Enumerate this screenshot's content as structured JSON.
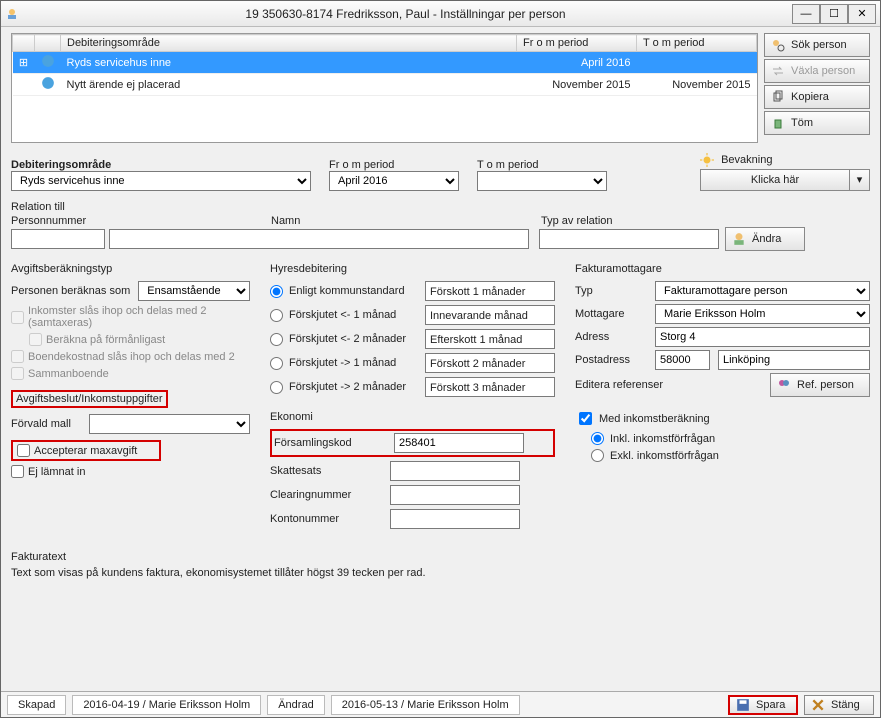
{
  "window": {
    "title": "19 350630-8174 Fredriksson, Paul - Inställningar per person"
  },
  "grid": {
    "headers": {
      "area": "Debiteringsområde",
      "from": "Fr o m period",
      "to": "T o m period"
    },
    "rows": [
      {
        "area": "Ryds servicehus inne",
        "from": "April 2016",
        "to": "",
        "selected": true,
        "expand": true
      },
      {
        "area": "Nytt ärende ej placerad",
        "from": "November 2015",
        "to": "November 2015",
        "selected": false,
        "expand": false
      }
    ]
  },
  "buttons": {
    "sok": "Sök person",
    "vaxla": "Växla person",
    "kopiera": "Kopiera",
    "tom": "Töm"
  },
  "filters": {
    "area_label": "Debiteringsområde",
    "area_value": "Ryds servicehus inne",
    "from_label": "Fr o m period",
    "from_value": "April 2016",
    "to_label": "T o m period",
    "to_value": ""
  },
  "bevak": {
    "label": "Bevakning",
    "button": "Klicka här"
  },
  "relation": {
    "header": "Relation till",
    "pnr": "Personnummer",
    "namn": "Namn",
    "typ": "Typ av relation",
    "andra": "Ändra"
  },
  "avgift": {
    "header": "Avgiftsberäkningstyp",
    "beraknas_label": "Personen beräknas som",
    "beraknas_value": "Ensamstående",
    "cb_inkomster": "Inkomster slås ihop och delas med 2 (samtaxeras)",
    "cb_forman": "Beräkna på förmånligast",
    "cb_boende": "Boendekostnad slås ihop och delas med 2",
    "cb_sambo": "Sammanboende",
    "beslut_header": "Avgiftsbeslut/Inkomstuppgifter",
    "mall_label": "Förvald mall",
    "cb_max": "Accepterar maxavgift",
    "cb_ej": "Ej lämnat in"
  },
  "hyra": {
    "header": "Hyresdebitering",
    "opt_std": "Enligt kommunstandard",
    "opt_b1": "Förskjutet <- 1 månad",
    "opt_b2": "Förskjutet <- 2 månader",
    "opt_f1": "Förskjutet -> 1 månad",
    "opt_f2": "Förskjutet -> 2 månader",
    "val_std": "Förskott 1 månader",
    "val_b1": "Innevarande månad",
    "val_b2": "Efterskott 1 månad",
    "val_f1": "Förskott 2 månader",
    "val_f2": "Förskott 3 månader",
    "ekonomi": "Ekonomi",
    "forsamling_label": "Församlingskod",
    "forsamling_value": "258401",
    "skatt": "Skattesats",
    "clearing": "Clearingnummer",
    "konto": "Kontonummer"
  },
  "faktmott": {
    "header": "Fakturamottagare",
    "typ_label": "Typ",
    "typ_value": "Fakturamottagare person",
    "mott_label": "Mottagare",
    "mott_value": "Marie Eriksson Holm",
    "adr_label": "Adress",
    "adr_value": "Storg 4",
    "post_label": "Postadress",
    "post_zip": "58000",
    "post_city": "Linköping",
    "editref": "Editera referenser",
    "refperson": "Ref. person",
    "medink": "Med inkomstberäkning",
    "inkl": "Inkl. inkomstförfrågan",
    "exkl": "Exkl. inkomstförfrågan"
  },
  "fakturatext": {
    "header": "Fakturatext",
    "desc": "Text som visas på kundens faktura, ekonomisystemet tillåter högst 39 tecken per rad."
  },
  "status": {
    "skapad_lbl": "Skapad",
    "skapad_val": "2016-04-19 / Marie Eriksson Holm",
    "andrad_lbl": "Ändrad",
    "andrad_val": "2016-05-13 / Marie Eriksson Holm",
    "spara": "Spara",
    "stang": "Stäng"
  }
}
